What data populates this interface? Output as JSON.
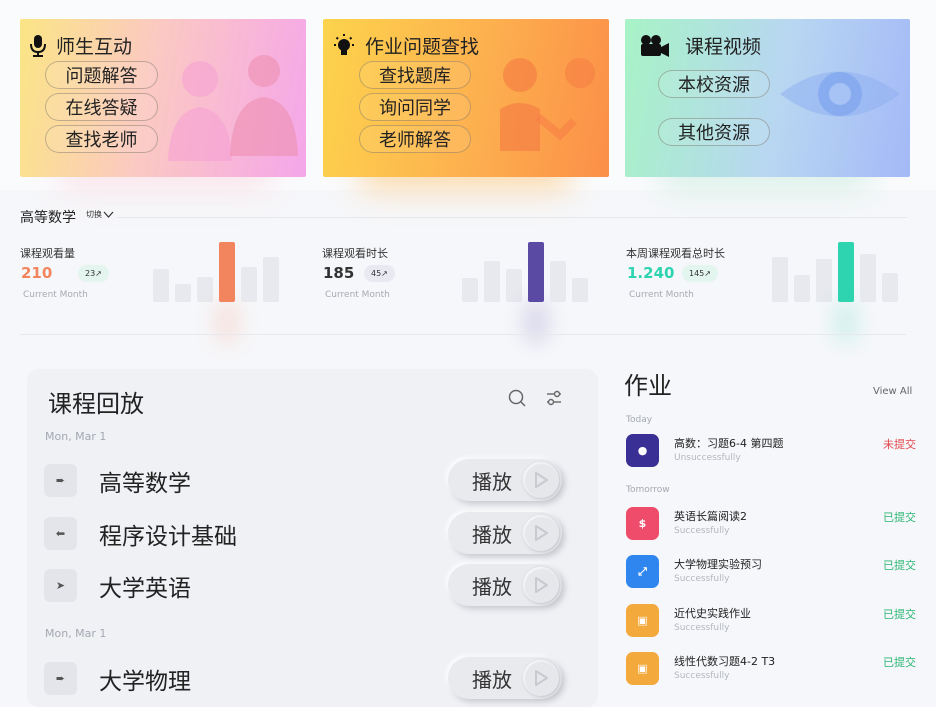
{
  "cards": [
    {
      "title": "师生互动",
      "icon": "microphone-icon",
      "items": [
        "问题解答",
        "在线答疑",
        "查找老师"
      ]
    },
    {
      "title": "作业问题查找",
      "icon": "lightbulb-icon",
      "items": [
        "查找题库",
        "询问同学",
        "老师解答"
      ]
    },
    {
      "title": "课程视频",
      "icon": "video-camera-icon",
      "items": [
        "本校资源",
        "其他资源"
      ]
    }
  ],
  "stats": {
    "course": "高等数学",
    "switch_label": "切换",
    "items": [
      {
        "label": "课程观看量",
        "value": "210",
        "badge": "23↗",
        "sub": "Current Month",
        "color": "#f2855e",
        "bars": [
          0.55,
          0.3,
          0.42,
          1.0,
          0.58,
          0.75
        ]
      },
      {
        "label": "课程观看时长",
        "value": "185",
        "badge": "45↗",
        "sub": "Current Month",
        "color": "#5b4aa3",
        "bars": [
          0.4,
          0.68,
          0.55,
          1.0,
          0.68,
          0.4
        ]
      },
      {
        "label": "本周课程观看总时长",
        "value": "1.240",
        "badge": "145↗",
        "sub": "Current Month",
        "color": "#2ed3b0",
        "bars": [
          0.75,
          0.45,
          0.72,
          1.0,
          0.8,
          0.48
        ]
      }
    ]
  },
  "replay": {
    "title": "课程回放",
    "search_icon": "search-icon",
    "filter_icon": "filter-icon",
    "groups": [
      {
        "date": "Mon, Mar 1",
        "courses": [
          {
            "name": "高等数学",
            "play": "播放"
          },
          {
            "name": "程序设计基础",
            "play": "播放"
          },
          {
            "name": "大学英语",
            "play": "播放"
          }
        ]
      },
      {
        "date": "Mon, Mar 1",
        "courses": [
          {
            "name": "大学物理",
            "play": "播放"
          }
        ]
      }
    ]
  },
  "homework": {
    "title": "作业",
    "view_all": "View All",
    "today_label": "Today",
    "tomorrow_label": "Tomorrow",
    "items": [
      {
        "name": "高数：习题6-4 第四题",
        "sub": "Unsuccessfully",
        "status": "未提交",
        "status_color": "#e2474c",
        "icon_color": "#3a2f94",
        "icon": "drop-icon"
      },
      {
        "name": "英语长篇阅读2",
        "sub": "Successfully",
        "status": "已提交",
        "status_color": "#2bb673",
        "icon_color": "#ee4c6a",
        "icon": "dollar-icon"
      },
      {
        "name": "大学物理实验预习",
        "sub": "Successfully",
        "status": "已提交",
        "status_color": "#2bb673",
        "icon_color": "#2f86ee",
        "icon": "flask-icon"
      },
      {
        "name": "近代史实践作业",
        "sub": "Successfully",
        "status": "已提交",
        "status_color": "#2bb673",
        "icon_color": "#f3a93c",
        "icon": "book-icon"
      },
      {
        "name": "线性代数习题4-2 T3",
        "sub": "Successfully",
        "status": "已提交",
        "status_color": "#2bb673",
        "icon_color": "#f3a93c",
        "icon": "book-icon"
      }
    ]
  }
}
